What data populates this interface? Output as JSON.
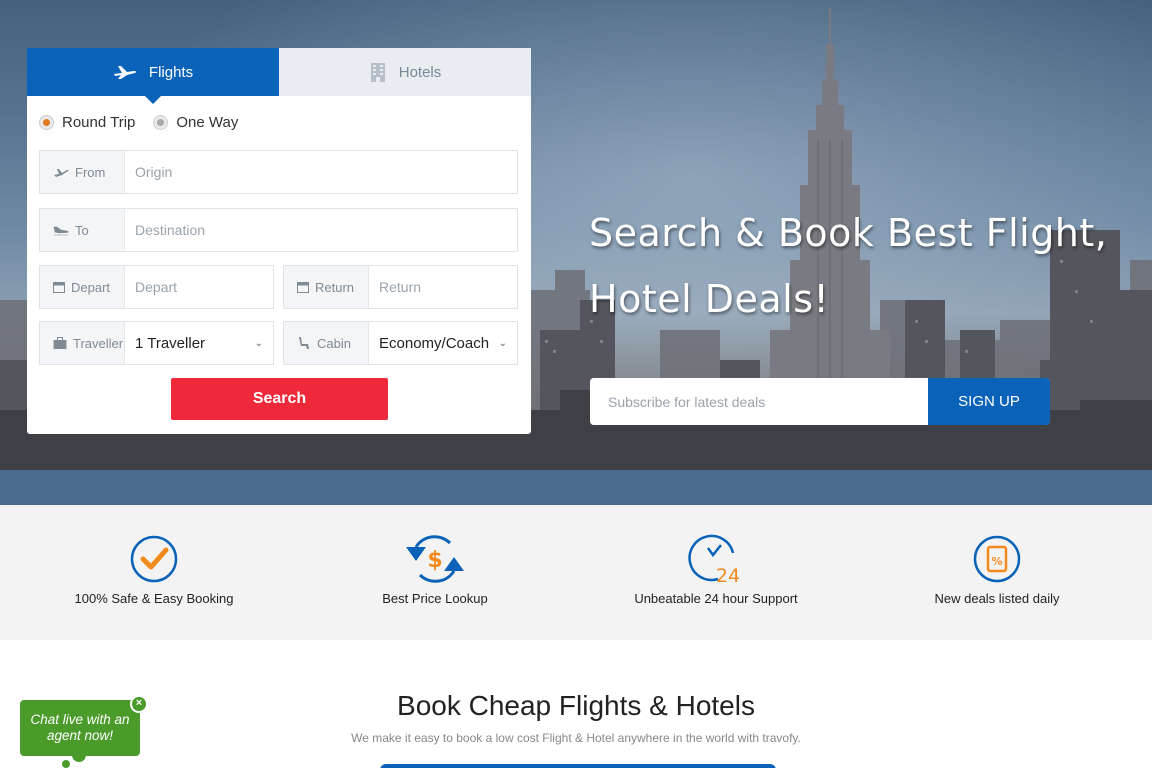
{
  "search_panel": {
    "tabs": [
      {
        "label": "Flights",
        "icon": "plane-icon",
        "active": true
      },
      {
        "label": "Hotels",
        "icon": "building-icon",
        "active": false
      }
    ],
    "trip_types": [
      {
        "label": "Round Trip",
        "selected": true
      },
      {
        "label": "One Way",
        "selected": false
      }
    ],
    "from": {
      "label": "From",
      "placeholder": "Origin"
    },
    "to": {
      "label": "To",
      "placeholder": "Destination"
    },
    "depart": {
      "label": "Depart",
      "placeholder": "Depart"
    },
    "return": {
      "label": "Return",
      "placeholder": "Return"
    },
    "traveller": {
      "label": "Traveller",
      "value": "1 Traveller"
    },
    "cabin": {
      "label": "Cabin",
      "value": "Economy/Coach"
    },
    "search_label": "Search"
  },
  "hero": {
    "headline": "Search & Book Best Flight, Hotel Deals!",
    "subscribe_placeholder": "Subscribe for latest deals",
    "signup_label": "SIGN UP"
  },
  "features": [
    {
      "label": "100% Safe & Easy Booking",
      "icon": "checkmark-circle-icon"
    },
    {
      "label": "Best Price Lookup",
      "icon": "dollar-arrows-icon"
    },
    {
      "label": "Unbeatable 24 hour Support",
      "icon": "clock-24-icon",
      "badge": "24"
    },
    {
      "label": "New deals listed daily",
      "icon": "discount-tag-icon"
    }
  ],
  "book_section": {
    "title": "Book Cheap Flights & Hotels",
    "subtitle": "We make it easy to book a low cost Flight & Hotel anywhere in the world with travofy."
  },
  "chat": {
    "label": "Chat live with an agent now!",
    "close": "×"
  },
  "colors": {
    "primary": "#0a63b8",
    "accent": "#e07a1f",
    "search": "#ee2a3a",
    "chat": "#4b9b2b"
  }
}
